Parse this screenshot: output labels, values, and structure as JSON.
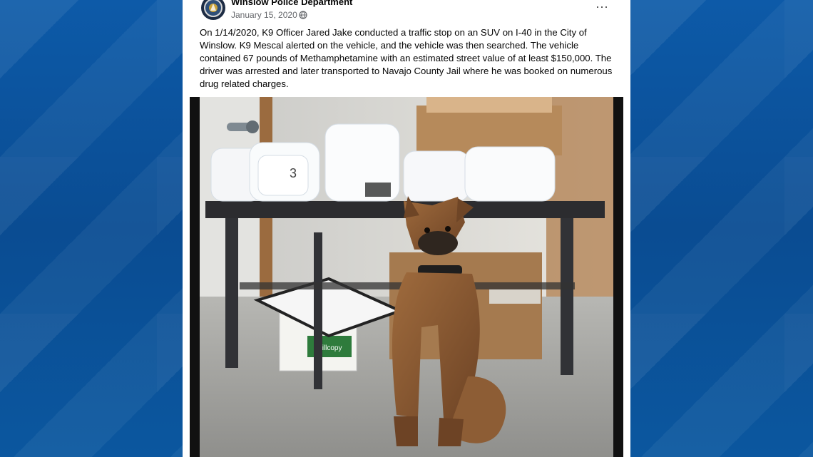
{
  "post": {
    "page_name": "Winslow Police Department",
    "date": "January 15, 2020",
    "date_separator": "·",
    "more_options": "···",
    "text": "On 1/14/2020, K9 Officer Jared Jake conducted a traffic stop on an SUV on I-40 in the City of Winslow. K9 Mescal alerted on the vehicle, and the vehicle was then searched. The vehicle contained 67 pounds of Methamphetamine with an estimated street value of at least $150,000. The driver was arrested and later transported to Navajo County Jail where he was booked on numerous drug related charges.",
    "photo": {
      "box_label": "willcopy",
      "bag_mark": "3"
    }
  },
  "icons": {
    "avatar": "police-badge-icon",
    "privacy": "globe-icon",
    "menu": "more-options-icon"
  },
  "colors": {
    "background": "#0a4f96",
    "card": "#ffffff",
    "text": "#050505",
    "muted": "#65676b"
  }
}
